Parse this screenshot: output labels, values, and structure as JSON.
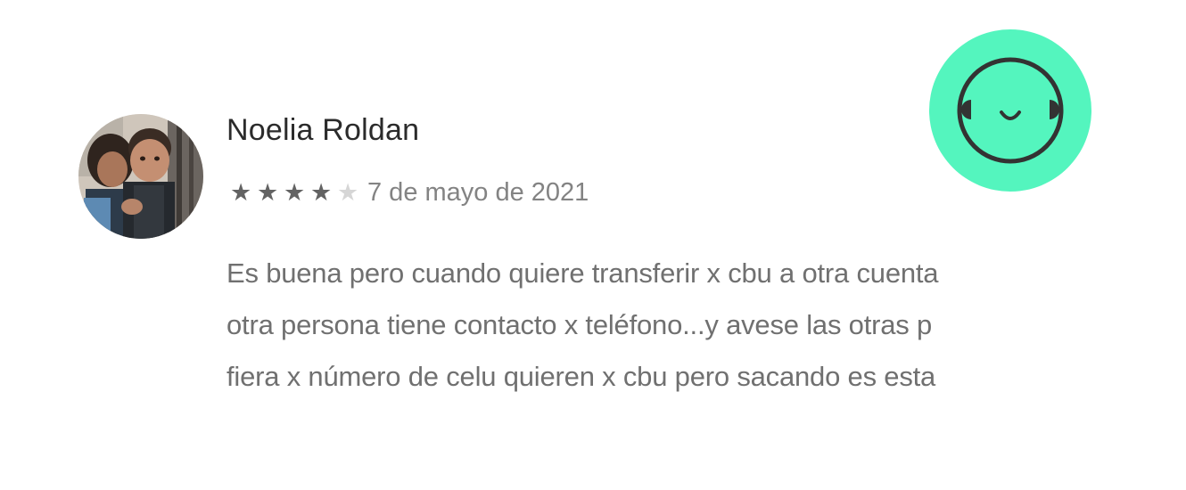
{
  "review": {
    "author": "Noelia Roldan",
    "rating": 4,
    "max_rating": 5,
    "star_glyph": "★",
    "date": "7 de mayo de 2021",
    "body_lines": [
      "Es buena pero cuando quiere transferir x cbu a otra cuenta",
      "otra persona tiene contacto x teléfono...y avese las otras p",
      "fiera x número de celu quieren x cbu pero sacando es esta"
    ]
  },
  "badge": {
    "icon": "smiley-face-icon",
    "color": "#54f5be"
  },
  "colors": {
    "star_filled": "#636363",
    "star_empty": "#d6d6d6",
    "name": "#2b2b2b",
    "date": "#838383",
    "body": "#707070"
  }
}
